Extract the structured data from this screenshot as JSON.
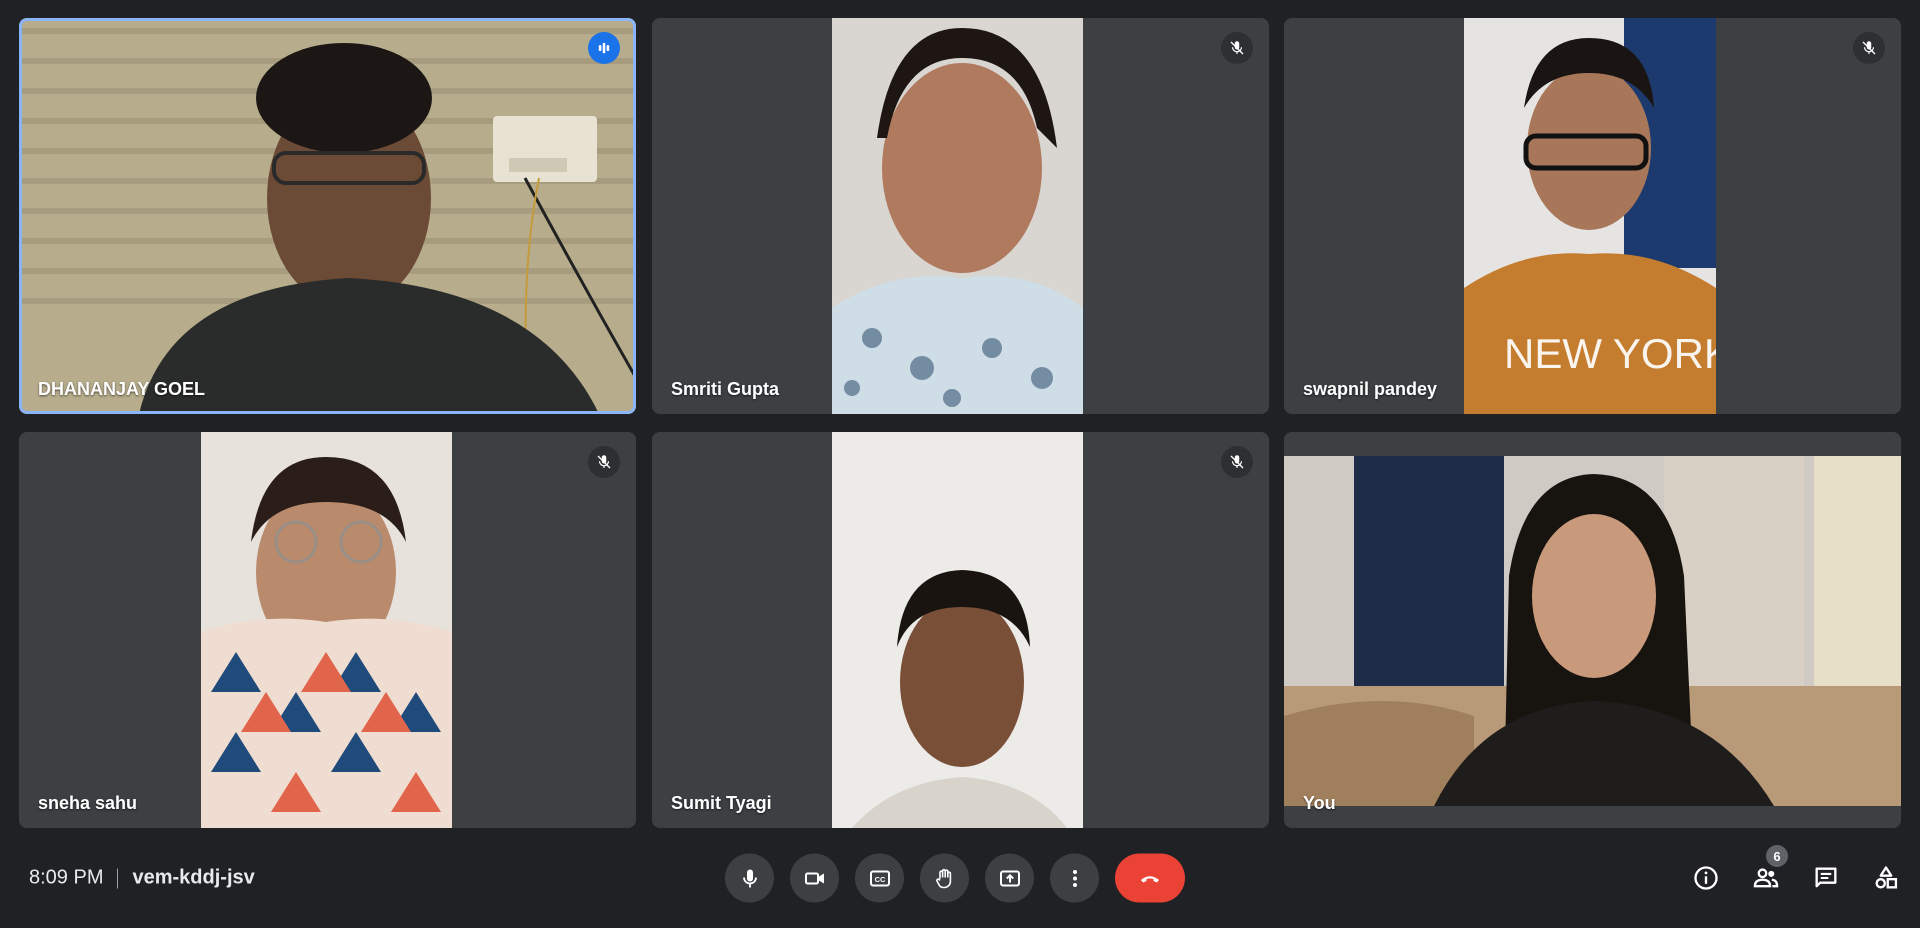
{
  "meeting": {
    "time": "8:09 PM",
    "code": "vem-kddj-jsv"
  },
  "participants": [
    {
      "name": "DHANANJAY GOEL",
      "status": "speaking",
      "status_icon": "speaking-indicator-icon"
    },
    {
      "name": "Smriti Gupta",
      "status": "muted",
      "status_icon": "mic-off-icon"
    },
    {
      "name": "swapnil pandey",
      "status": "muted",
      "status_icon": "mic-off-icon"
    },
    {
      "name": "sneha sahu",
      "status": "muted",
      "status_icon": "mic-off-icon"
    },
    {
      "name": "Sumit Tyagi",
      "status": "muted",
      "status_icon": "mic-off-icon"
    },
    {
      "name": "You",
      "status": "self",
      "status_icon": ""
    }
  ],
  "controls": [
    {
      "name": "microphone",
      "icon": "mic-icon"
    },
    {
      "name": "camera",
      "icon": "videocam-icon"
    },
    {
      "name": "captions",
      "icon": "closed-captions-icon"
    },
    {
      "name": "raise-hand",
      "icon": "hand-icon"
    },
    {
      "name": "present",
      "icon": "present-screen-icon"
    },
    {
      "name": "more-options",
      "icon": "more-vert-icon"
    },
    {
      "name": "leave-call",
      "icon": "call-end-icon"
    }
  ],
  "right_tools": {
    "people_count": "6",
    "items": [
      "info-icon",
      "people-icon",
      "chat-icon",
      "activities-icon"
    ]
  },
  "colors": {
    "background": "#202124",
    "tile": "#3c4043",
    "active_speaker_border": "#8ab4f8",
    "end_call": "#ea4335",
    "speaking_badge": "#1a73e8"
  }
}
